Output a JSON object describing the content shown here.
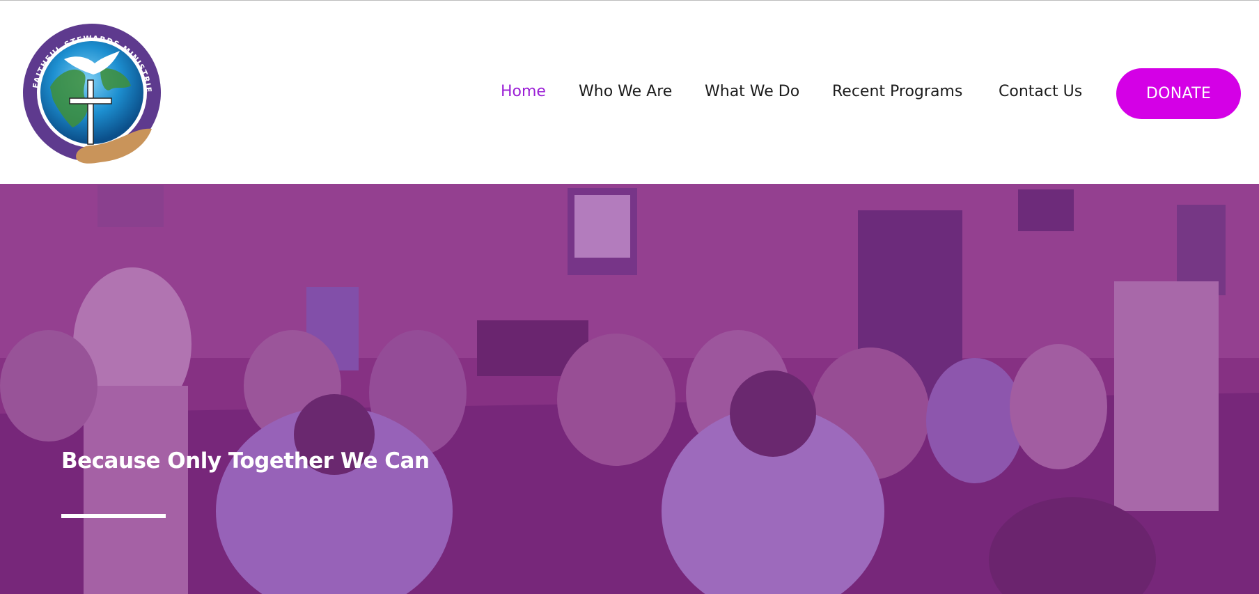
{
  "header": {
    "logo": {
      "icon": "globe-hand-cross-logo",
      "ring_text": "FAITHFUL STEWARDS MINISTRIES"
    },
    "nav": {
      "items": [
        {
          "label": "Home",
          "active": true
        },
        {
          "label": "Who We Are"
        },
        {
          "label": "What We Do"
        },
        {
          "label": "Recent Programs"
        },
        {
          "label": "Contact Us"
        }
      ]
    },
    "donate_label": "DONATE"
  },
  "hero": {
    "heading": "Because Only Together We Can",
    "image_semantic": "community-gathering-photo"
  },
  "colors": {
    "accent": "#9b1fd6",
    "donate_bg": "#d400e6",
    "hero_overlay": "#8a2f8c",
    "nav_text": "#1c1c1c",
    "logo_ring": "#5e3a8e"
  }
}
